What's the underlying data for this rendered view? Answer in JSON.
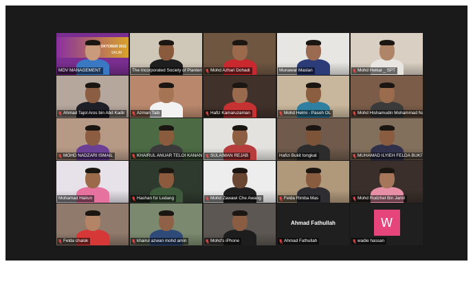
{
  "meeting": {
    "view": "gallery",
    "participants": [
      {
        "name": "MDV MANAGEMENT",
        "muted": false,
        "bg": "#7a2e8f",
        "skin": "#c99a7c",
        "shirt": "#3b78c4",
        "banner_text": "OKTOBER 2021",
        "banner_text2": "SALIM"
      },
      {
        "name": "The Incorporated Society of Planters",
        "muted": false,
        "active": true,
        "bg": "#cfc7b8",
        "skin": "#8a5a3d",
        "shirt": "#1e1e1e"
      },
      {
        "name": "Mohd Azhari Dohadi",
        "muted": true,
        "bg": "#6e5641",
        "skin": "#9b6a4c",
        "shirt": "#c8282e"
      },
      {
        "name": "Munawar Maslan",
        "muted": false,
        "bg": "#e8e6e3",
        "skin": "#9a6b50",
        "shirt": "#2b3c78"
      },
      {
        "name": "Mohd Heikal _ SPT",
        "muted": true,
        "bg": "#d9cfc2",
        "skin": "#b08466",
        "shirt": "#e9e6e2"
      },
      {
        "name": "Ahmad Tajol Aros bin Abd Kadir",
        "muted": true,
        "bg": "#b6a79c",
        "skin": "#8b5e43",
        "shirt": "#1f1f28"
      },
      {
        "name": "Azman Taib",
        "muted": true,
        "bg": "#b9886c",
        "skin": "#a57454",
        "shirt": "#f2f2f2"
      },
      {
        "name": "Hafiz Kamaruzaman",
        "muted": true,
        "bg": "#40312a",
        "skin": "#9a6a4e",
        "shirt": "#c63131"
      },
      {
        "name": "Mohd Helmi - Pasoh OL",
        "muted": true,
        "bg": "#c8b79c",
        "skin": "#8c5e40",
        "shirt": "#2e7fa0"
      },
      {
        "name": "Mohd Hishamudin Mohammad Na...",
        "muted": true,
        "bg": "#7a5c48",
        "skin": "#9b6b4e",
        "shirt": "#3a3a3a"
      },
      {
        "name": "MOHD NADZARI ISMAIL",
        "muted": true,
        "bg": "#b79a86",
        "skin": "#8c5d41",
        "shirt": "#6b3f93"
      },
      {
        "name": "KHAIRUL ANUAR TELOI KANAN",
        "muted": true,
        "bg": "#4c6b44",
        "skin": "#8b5b3e",
        "shirt": "#3a3a3a"
      },
      {
        "name": "SULAIMAN REJAB",
        "muted": true,
        "bg": "#e3e2de",
        "skin": "#8d5e41",
        "shirt": "#b73d3d"
      },
      {
        "name": "Hafizi Bukit tongkat",
        "muted": false,
        "bg": "#6f5a4c",
        "skin": "#7e5439",
        "shirt": "#2c2c2c"
      },
      {
        "name": "MUHAMAD ILYIEH FELDA BUKIT ...",
        "muted": true,
        "bg": "#83705c",
        "skin": "#8a5c40",
        "shirt": "#30304a"
      },
      {
        "name": "Mohamad Hairun",
        "muted": false,
        "bg": "#e7e2ea",
        "skin": "#9a6a4b",
        "shirt": "#e6739f"
      },
      {
        "name": "Hashan fsr Ledang",
        "muted": true,
        "bg": "#2f3a2e",
        "skin": "#8c5b3e",
        "shirt": "#3d5a3b"
      },
      {
        "name": "Mohd Zawawi Che Awang",
        "muted": true,
        "bg": "#ededed",
        "skin": "#6a4733",
        "shirt": "#202020"
      },
      {
        "name": "Felda Rimba Mas",
        "muted": true,
        "bg": "#b0997b",
        "skin": "#8a5c3f",
        "shirt": "#2d2d32"
      },
      {
        "name": "Mohd Rodzhel Bin Jamil",
        "muted": true,
        "bg": "#3a2f2a",
        "skin": "#a5765a",
        "shirt": "#e88fa8"
      },
      {
        "name": "Felda chalok",
        "muted": true,
        "bg": "#8f7a6c",
        "skin": "#b48466",
        "shirt": "#d63838"
      },
      {
        "name": "khairul azwan mohd amin",
        "muted": true,
        "bg": "#7b8a6f",
        "skin": "#8f6247",
        "shirt": "#2d4a78"
      },
      {
        "name": "Mohd's iPhone",
        "muted": true,
        "bg": "#5c5752",
        "skin": "#8a5d43",
        "shirt": "#1d1d1d"
      },
      {
        "name": "Ahmad Fathullah",
        "muted": true,
        "video_off": true,
        "bg": "#1f1f1f"
      },
      {
        "name": "wadie hassan",
        "muted": true,
        "video_off": true,
        "avatar_letter": "W",
        "avatar_color": "#e6457c",
        "bg": "#1f1f1f"
      }
    ]
  }
}
